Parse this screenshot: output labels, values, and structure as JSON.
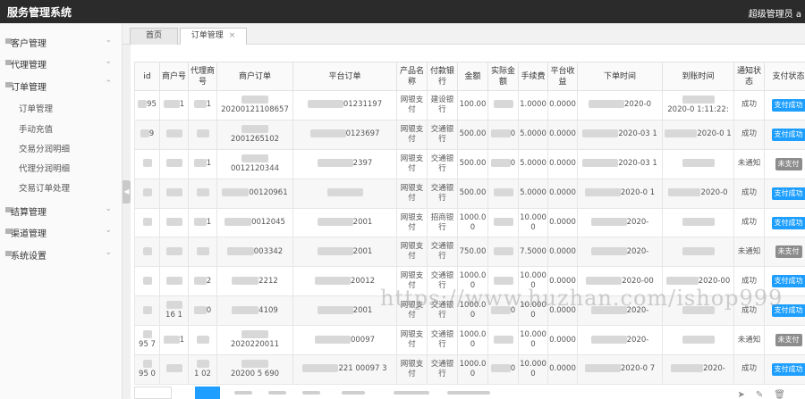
{
  "header": {
    "app_title": "服务管理系统",
    "user": "超级管理员 a"
  },
  "sidebar": {
    "groups": [
      {
        "label": "客户管理"
      },
      {
        "label": "代理管理"
      },
      {
        "label": "订单管理",
        "sub": [
          "订单管理",
          "手动充值",
          "交易分润明细",
          "代理分润明细",
          "交易订单处理"
        ]
      },
      {
        "label": "结算管理"
      },
      {
        "label": "渠道管理"
      },
      {
        "label": "系统设置"
      }
    ]
  },
  "tabs": [
    {
      "label": "首页"
    },
    {
      "label": "订单管理",
      "close": "×"
    }
  ],
  "table": {
    "headers": [
      "id",
      "商户号",
      "代理商号",
      "商户订单",
      "平台订单",
      "产品名称",
      "付款银行",
      "金额",
      "实际金额",
      "手续费",
      "平台收益",
      "下单时间",
      "到账时间",
      "通知状态",
      "支付状态"
    ],
    "rows": [
      {
        "id": "95",
        "merchant": "1",
        "agent": "1",
        "mch_order": "20200121108657",
        "plat_order": "01231197",
        "product": "网银支付",
        "bank": "建设银行",
        "amount": "100.00",
        "actual": "",
        "fee": "1.0000",
        "profit": "0.0000",
        "order_time": "2020-0",
        "arrive_time": "2020-0 1:11:22:",
        "notify": "成功",
        "pay": "支付成功",
        "pay_type": "success"
      },
      {
        "id": "9",
        "merchant": "",
        "agent": "",
        "mch_order": "2001265102",
        "plat_order": "0123697",
        "product": "网银支付",
        "bank": "交通银行",
        "amount": "500.00",
        "actual": "0",
        "fee": "5.0000",
        "profit": "0.0000",
        "order_time": "2020-03 1",
        "arrive_time": "2020-0 1",
        "notify": "成功",
        "pay": "支付成功",
        "pay_type": "success"
      },
      {
        "id": "",
        "merchant": "",
        "agent": "1",
        "mch_order": "0012120344",
        "plat_order": "2397",
        "product": "网银支付",
        "bank": "交通银行",
        "amount": "500.00",
        "actual": "0",
        "fee": "5.0000",
        "profit": "0.0000",
        "order_time": "2020-03 1",
        "arrive_time": "",
        "notify": "未通知",
        "pay": "未支付",
        "pay_type": "pending"
      },
      {
        "id": "",
        "merchant": "",
        "agent": "",
        "mch_order": "00120961",
        "plat_order": "",
        "product": "网银支付",
        "bank": "交通银行",
        "amount": "500.00",
        "actual": "",
        "fee": "5.0000",
        "profit": "0.0000",
        "order_time": "2020-0 1",
        "arrive_time": "2020-0",
        "notify": "成功",
        "pay": "支付成功",
        "pay_type": "success"
      },
      {
        "id": "",
        "merchant": "",
        "agent": "1",
        "mch_order": "0012045",
        "plat_order": "2001",
        "product": "网银支付",
        "bank": "招商银行",
        "amount": "1000.0 0",
        "actual": "",
        "fee": "10.000 0",
        "profit": "0.0000",
        "order_time": "2020-",
        "arrive_time": "",
        "notify": "成功",
        "pay": "支付成功",
        "pay_type": "success"
      },
      {
        "id": "",
        "merchant": "",
        "agent": "",
        "mch_order": "003342",
        "plat_order": "2001",
        "product": "网银支付",
        "bank": "交通银行",
        "amount": "750.00",
        "actual": "",
        "fee": "7.5000",
        "profit": "0.0000",
        "order_time": "2020-",
        "arrive_time": "",
        "notify": "未通知",
        "pay": "未支付",
        "pay_type": "pending"
      },
      {
        "id": "",
        "merchant": "",
        "agent": "2",
        "mch_order": "2212",
        "plat_order": "20012",
        "product": "网银支付",
        "bank": "交通银行",
        "amount": "1000.0 0",
        "actual": "",
        "fee": "10.000 0",
        "profit": "0.0000",
        "order_time": "2020-00",
        "arrive_time": "2020-00",
        "notify": "成功",
        "pay": "支付成功",
        "pay_type": "success"
      },
      {
        "id": "",
        "merchant": "16 1",
        "agent": "0",
        "mch_order": "4109",
        "plat_order": "2001",
        "product": "网银支付",
        "bank": "交通银行",
        "amount": "1000.0 0",
        "actual": "0",
        "fee": "10.000 0",
        "profit": "0.0000",
        "order_time": "2020-",
        "arrive_time": "",
        "notify": "成功",
        "pay": "支付成功",
        "pay_type": "success"
      },
      {
        "id": "95 7",
        "merchant": "1",
        "agent": "",
        "mch_order": "2020220011",
        "plat_order": "00097",
        "product": "网银支付",
        "bank": "交通银行",
        "amount": "1000.0 0",
        "actual": "",
        "fee": "10.000 0",
        "profit": "0.0000",
        "order_time": "2020-",
        "arrive_time": "",
        "notify": "未通知",
        "pay": "未支付",
        "pay_type": "pending"
      },
      {
        "id": "95 0",
        "merchant": "",
        "agent": "1 02",
        "mch_order": "20200 5 690",
        "plat_order": "221 00097 3",
        "product": "网银支付",
        "bank": "交通银行",
        "amount": "1000.0 0",
        "actual": "0",
        "fee": "10.000 0",
        "profit": "0.0000",
        "order_time": "2020-0 7",
        "arrive_time": "2020-",
        "notify": "成功",
        "pay": "支付成功",
        "pay_type": "success"
      }
    ]
  },
  "watermark": "https://www.huzhan.com/ishop999",
  "colors": {
    "topbar": "#2b2b2b",
    "success_badge": "#1e9fff",
    "pending_badge": "#8c8c8c",
    "selected_page": "#1e9fff"
  },
  "icons": {
    "group_bullet": "square-bullet-icon",
    "chevron": "chevron-down-icon",
    "collapse": "triangle-left-icon",
    "tab_close": "close-icon"
  }
}
